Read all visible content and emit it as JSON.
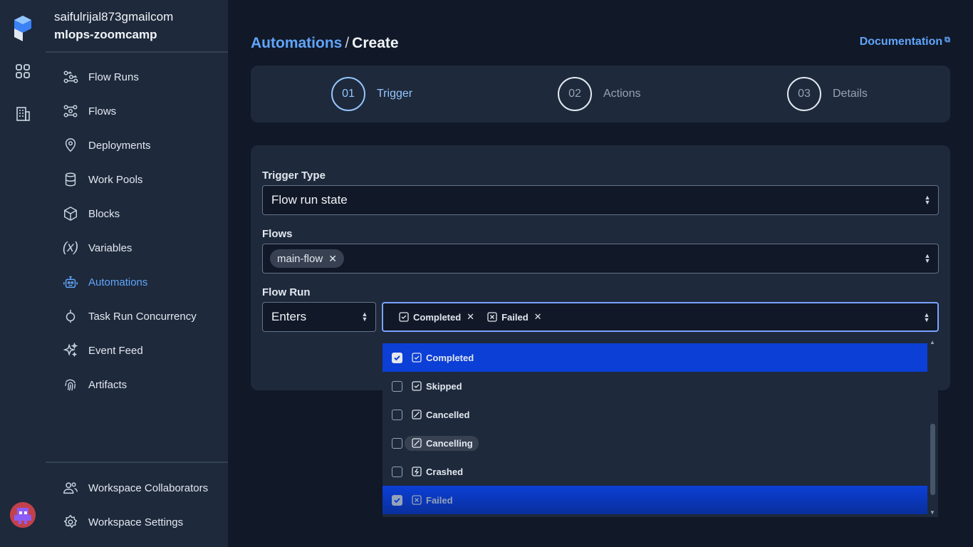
{
  "workspace": {
    "account": "saifulrijal873gmailcom",
    "name": "mlops-zoomcamp"
  },
  "sidebar": {
    "items": [
      {
        "label": "Flow Runs",
        "icon": "flow-runs-icon"
      },
      {
        "label": "Flows",
        "icon": "flows-icon"
      },
      {
        "label": "Deployments",
        "icon": "location-pin-icon"
      },
      {
        "label": "Work Pools",
        "icon": "database-icon"
      },
      {
        "label": "Blocks",
        "icon": "cube-icon"
      },
      {
        "label": "Variables",
        "icon": "variable-icon"
      },
      {
        "label": "Automations",
        "icon": "robot-icon",
        "active": true
      },
      {
        "label": "Task Run Concurrency",
        "icon": "concurrency-icon"
      },
      {
        "label": "Event Feed",
        "icon": "sparkles-icon"
      },
      {
        "label": "Artifacts",
        "icon": "fingerprint-icon"
      }
    ],
    "bottom": [
      {
        "label": "Workspace Collaborators",
        "icon": "users-icon"
      },
      {
        "label": "Workspace Settings",
        "icon": "gear-icon"
      }
    ],
    "variables_glyph": "(x)"
  },
  "breadcrumb": {
    "parent": "Automations",
    "separator": "/",
    "current": "Create"
  },
  "documentation": {
    "label": "Documentation",
    "ext_glyph": "⧉"
  },
  "steps": [
    {
      "number": "01",
      "label": "Trigger",
      "active": true
    },
    {
      "number": "02",
      "label": "Actions",
      "active": false
    },
    {
      "number": "03",
      "label": "Details",
      "active": false
    }
  ],
  "form": {
    "trigger_type": {
      "label": "Trigger Type",
      "value": "Flow run state"
    },
    "flows": {
      "label": "Flows",
      "chips": [
        "main-flow"
      ]
    },
    "flow_run": {
      "label": "Flow Run",
      "mode": "Enters",
      "states": [
        "Completed",
        "Failed"
      ]
    }
  },
  "dropdown": {
    "options": [
      {
        "label": "Completed",
        "checked": true
      },
      {
        "label": "Skipped",
        "checked": false
      },
      {
        "label": "Cancelled",
        "checked": false
      },
      {
        "label": "Cancelling",
        "checked": false
      },
      {
        "label": "Crashed",
        "checked": false
      },
      {
        "label": "Failed",
        "checked": true
      }
    ]
  },
  "glyphs": {
    "remove": "✕",
    "caret_up": "▲",
    "caret_down": "▼",
    "check": "✓"
  },
  "colors": {
    "accent": "#60a5fa",
    "selected_option": "#0b3fd6",
    "background": "#111827",
    "panel": "#1e293b"
  }
}
